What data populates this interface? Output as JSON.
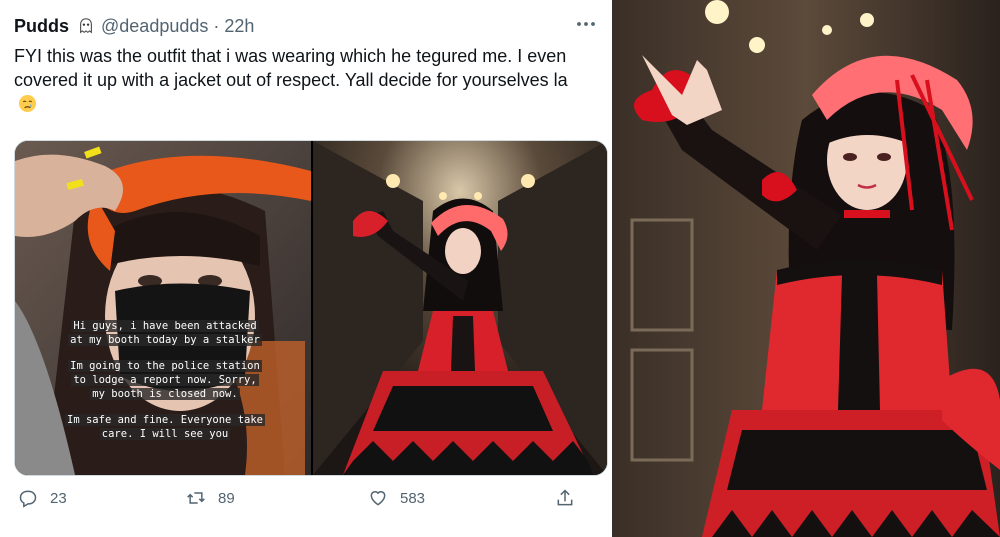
{
  "tweet": {
    "display_name": "Pudds",
    "handle": "@deadpudds",
    "separator": "·",
    "time": "22h",
    "text": "FYI this was the outfit that i was wearing which he tegured me. I even covered it up with a jacket out of respect. Yall decide for yourselves la",
    "emoji": "crying-face-emoji",
    "media": {
      "story_caption": [
        "Hi guys, i have been attacked at my booth today by a stalker",
        "Im going to the police station to lodge a report now. Sorry, my booth is closed now.",
        "Im safe and fine. Everyone take care. I will see you"
      ]
    },
    "actions": {
      "replies": "23",
      "retweets": "89",
      "likes": "583"
    }
  },
  "colors": {
    "text_primary": "#0f1419",
    "text_secondary": "#536471",
    "border": "#cfd9de",
    "costume_red": "#e0282f"
  }
}
